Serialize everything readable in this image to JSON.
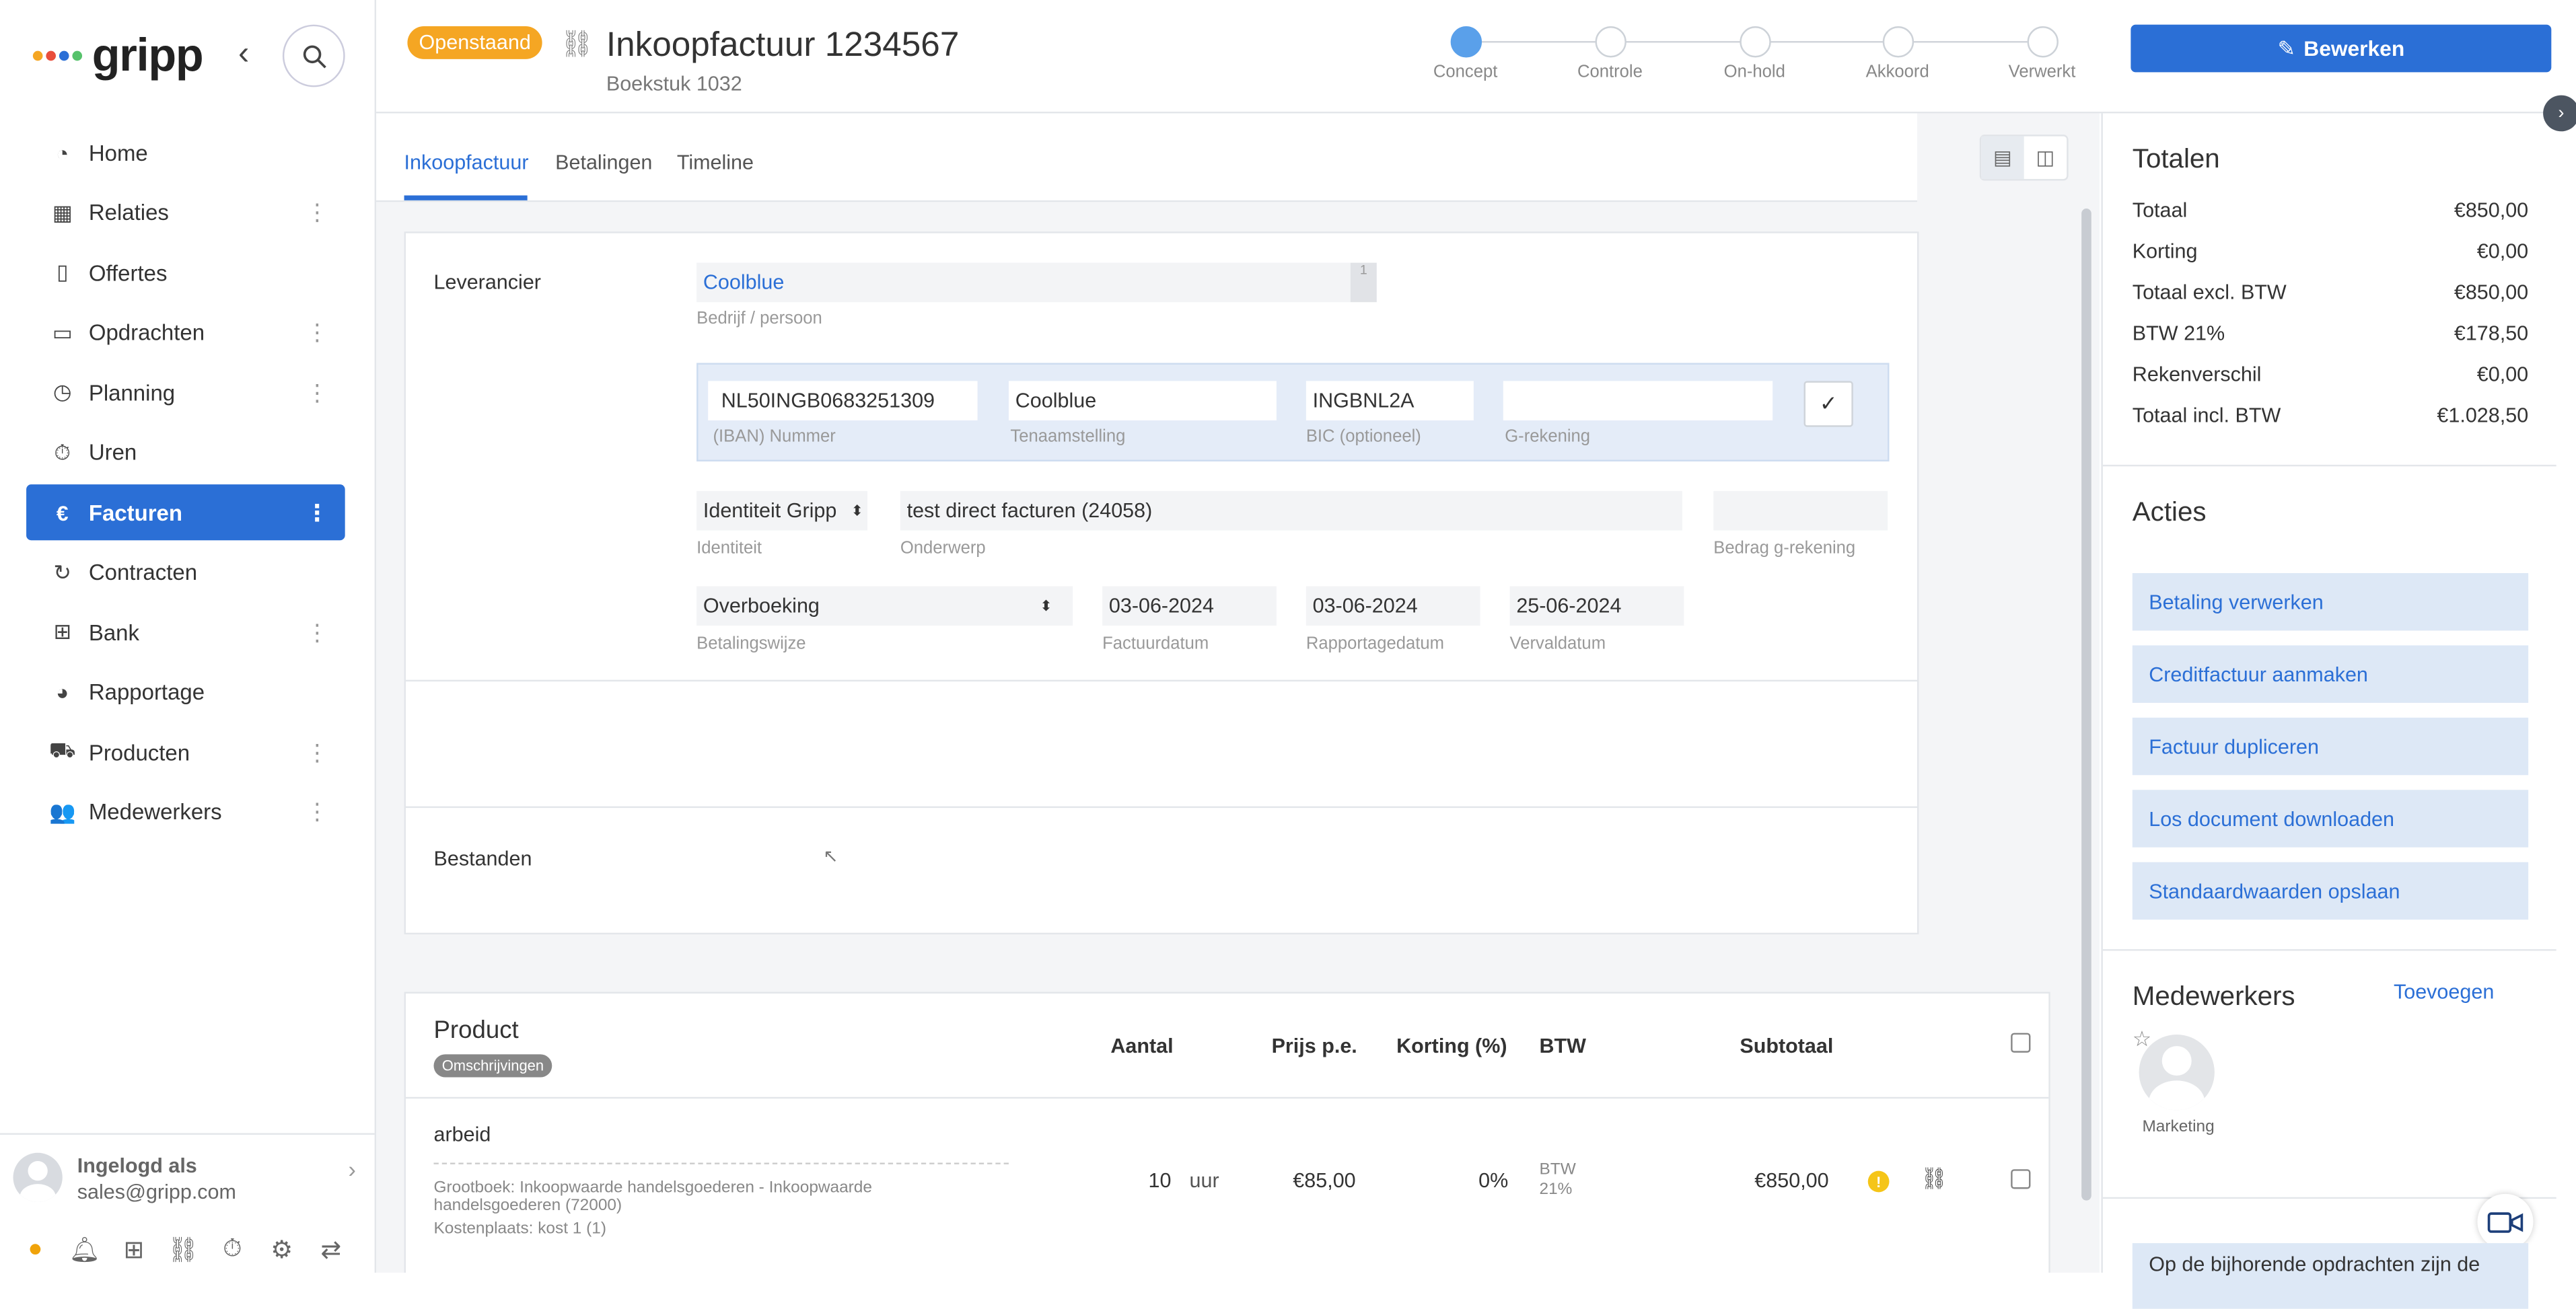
{
  "brand": {
    "name": "gripp",
    "accent": "#2b6fd6",
    "warning": "#f5a623"
  },
  "sidebar": {
    "items": [
      {
        "label": "Home",
        "icon": "dashboard-icon",
        "more": false
      },
      {
        "label": "Relaties",
        "icon": "building-icon",
        "more": true
      },
      {
        "label": "Offertes",
        "icon": "document-icon",
        "more": false
      },
      {
        "label": "Opdrachten",
        "icon": "folder-icon",
        "more": true
      },
      {
        "label": "Planning",
        "icon": "clock-icon",
        "more": true
      },
      {
        "label": "Uren",
        "icon": "stopwatch-icon",
        "more": false
      },
      {
        "label": "Facturen",
        "icon": "euro-icon",
        "more": true,
        "active": true
      },
      {
        "label": "Contracten",
        "icon": "refresh-icon",
        "more": false
      },
      {
        "label": "Bank",
        "icon": "bank-icon",
        "more": true
      },
      {
        "label": "Rapportage",
        "icon": "pie-chart-icon",
        "more": false
      },
      {
        "label": "Producten",
        "icon": "cart-icon",
        "more": true
      },
      {
        "label": "Medewerkers",
        "icon": "users-icon",
        "more": true
      }
    ],
    "user": {
      "label": "Ingelogd als",
      "email": "sales@gripp.com"
    }
  },
  "header": {
    "status": "Openstaand",
    "title": "Inkoopfactuur 1234567",
    "subtitle": "Boekstuk 1032",
    "steps": [
      "Concept",
      "Controle",
      "On-hold",
      "Akkoord",
      "Verwerkt"
    ],
    "edit_label": "Bewerken"
  },
  "tabs": [
    "Inkoopfactuur",
    "Betalingen",
    "Timeline"
  ],
  "form": {
    "leverancier_label": "Leverancier",
    "leverancier_value": "Coolblue",
    "leverancier_sub": "Bedrijf / persoon",
    "counter": "1",
    "iban": {
      "value": "NL50INGB0683251309",
      "label": "(IBAN) Nummer"
    },
    "tenaam": {
      "value": "Coolblue",
      "label": "Tenaamstelling"
    },
    "bic": {
      "value": "INGBNL2A",
      "label": "BIC (optioneel)"
    },
    "grekening": {
      "value": "",
      "label": "G-rekening"
    },
    "check_label": "✓",
    "identiteit": {
      "value": "Identiteit Gripp",
      "label": "Identiteit"
    },
    "onderwerp": {
      "value": "test direct facturen (24058)",
      "label": "Onderwerp"
    },
    "bedrag_g": {
      "value": "",
      "label": "Bedrag g-rekening"
    },
    "betalingswijze": {
      "value": "Overboeking",
      "label": "Betalingswijze"
    },
    "factuurdatum": {
      "value": "03-06-2024",
      "label": "Factuurdatum"
    },
    "rapportagedatum": {
      "value": "03-06-2024",
      "label": "Rapportagedatum"
    },
    "vervaldatum": {
      "value": "25-06-2024",
      "label": "Vervaldatum"
    },
    "bestanden_label": "Bestanden"
  },
  "products": {
    "headers": {
      "product": "Product",
      "aantal": "Aantal",
      "prijs": "Prijs p.e.",
      "korting": "Korting (%)",
      "btw": "BTW",
      "subtotaal": "Subtotaal"
    },
    "omschrijvingen": "Omschrijvingen",
    "rows": [
      {
        "name": "arbeid",
        "grootboek": "Grootboek: Inkoopwaarde handelsgoederen - Inkoopwaarde handelsgoederen (72000)",
        "kostenplaats": "Kostenplaats: kost 1 (1)",
        "aantal": "10",
        "eenheid": "uur",
        "prijs": "€85,00",
        "korting": "0%",
        "btw_line1": "BTW",
        "btw_line2": "21%",
        "subtotaal": "€850,00"
      }
    ]
  },
  "totals": {
    "title": "Totalen",
    "rows": [
      {
        "label": "Totaal",
        "value": "€850,00"
      },
      {
        "label": "Korting",
        "value": "€0,00"
      },
      {
        "label": "Totaal excl. BTW",
        "value": "€850,00"
      },
      {
        "label": "BTW 21%",
        "value": "€178,50"
      },
      {
        "label": "Rekenverschil",
        "value": "€0,00"
      },
      {
        "label": "Totaal incl. BTW",
        "value": "€1.028,50"
      }
    ]
  },
  "actions": {
    "title": "Acties",
    "items": [
      "Betaling verwerken",
      "Creditfactuur aanmaken",
      "Factuur dupliceren",
      "Los document downloaden",
      "Standaardwaarden opslaan"
    ]
  },
  "medewerkers": {
    "title": "Medewerkers",
    "add_label": "Toevoegen",
    "members": [
      "Marketing"
    ]
  },
  "notice": "Op de bijhorende opdrachten zijn de"
}
